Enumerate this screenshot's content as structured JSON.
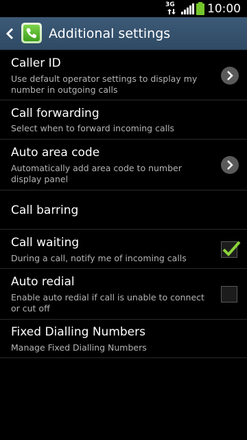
{
  "status_bar": {
    "network": "3G",
    "time": "10:00",
    "icons": [
      "3g-icon",
      "signal-icon",
      "battery-icon"
    ]
  },
  "action_bar": {
    "title": "Additional settings",
    "icons": [
      "back-icon",
      "phone-app-icon"
    ]
  },
  "settings": [
    {
      "label": "Caller ID",
      "summary": "Use default operator settings to display my number in outgoing calls",
      "control": "chevron"
    },
    {
      "label": "Call forwarding",
      "summary": "Select when to forward incoming calls",
      "control": "none"
    },
    {
      "label": "Auto area code",
      "summary": "Automatically add area code to number display panel",
      "control": "chevron"
    },
    {
      "label": "Call barring",
      "summary": "",
      "control": "none"
    },
    {
      "label": "Call waiting",
      "summary": "During a call, notify me of incoming calls",
      "control": "checkbox",
      "checked": true
    },
    {
      "label": "Auto redial",
      "summary": "Enable auto redial if call is unable to connect or cut off",
      "control": "checkbox",
      "checked": false
    },
    {
      "label": "Fixed Dialling Numbers",
      "summary": "Manage Fixed Dialling Numbers",
      "control": "none"
    }
  ],
  "colors": {
    "action_bar": "#3c5a77",
    "check_green": "#8bd13a",
    "battery": "#74c62a"
  }
}
